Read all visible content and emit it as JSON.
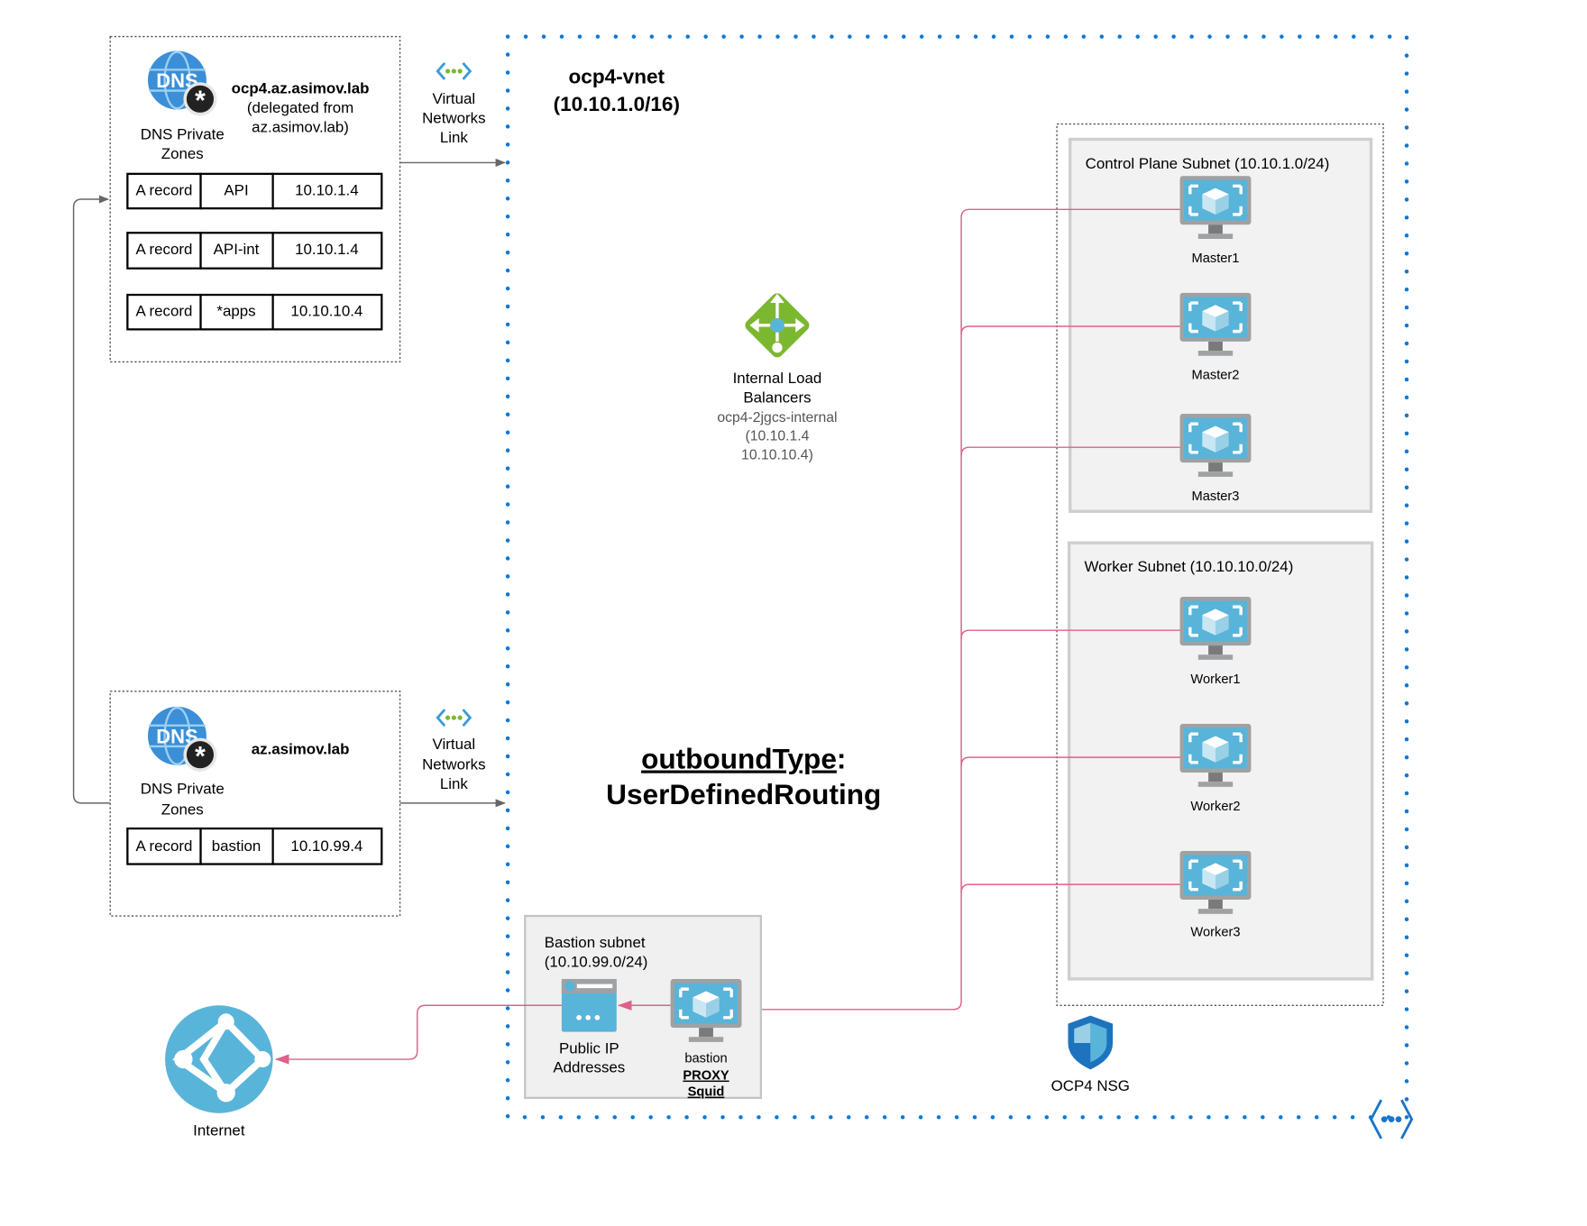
{
  "colors": {
    "vnet_border": "#0a78d7",
    "connection": "#e0608a",
    "subnet_fill": "#f2f2f2",
    "lb_green": "#7cb82f",
    "vm_blue": "#59b4d9"
  },
  "dns_zone_1": {
    "icon": "dns-private-zone-icon",
    "zone_name": "ocp4.az.asimov.lab",
    "zone_note_1": "(delegated from",
    "zone_note_2": "az.asimov.lab)",
    "label_1": "DNS Private",
    "label_2": "Zones",
    "records": [
      {
        "type": "A record",
        "name": "API",
        "ip": "10.10.1.4"
      },
      {
        "type": "A record",
        "name": "API-int",
        "ip": "10.10.1.4"
      },
      {
        "type": "A record",
        "name": "*apps",
        "ip": "10.10.10.4"
      }
    ]
  },
  "dns_zone_2": {
    "icon": "dns-private-zone-icon",
    "zone_name": "az.asimov.lab",
    "label_1": "DNS Private",
    "label_2": "Zones",
    "records": [
      {
        "type": "A record",
        "name": "bastion",
        "ip": "10.10.99.4"
      }
    ]
  },
  "vnet_link": {
    "line_1": "Virtual",
    "line_2": "Networks",
    "line_3": "Link"
  },
  "vnet": {
    "title_1": "ocp4-vnet",
    "title_2": "(10.10.1.0/16)"
  },
  "load_balancer": {
    "label_1": "Internal Load",
    "label_2": "Balancers",
    "name": "ocp4-2jgcs-internal",
    "ip_1": "(10.10.1.4",
    "ip_2": "10.10.10.4)"
  },
  "outbound": {
    "key": "outboundType",
    "colon": ":",
    "value": "UserDefinedRouting"
  },
  "control_plane": {
    "title": "Control Plane Subnet (10.10.1.0/24)",
    "nodes": [
      "Master1",
      "Master2",
      "Master3"
    ]
  },
  "worker": {
    "title": "Worker Subnet (10.10.10.0/24)",
    "nodes": [
      "Worker1",
      "Worker2",
      "Worker3"
    ]
  },
  "bastion_subnet": {
    "title_1": "Bastion subnet",
    "title_2": "(10.10.99.0/24)",
    "public_ip_1": "Public IP",
    "public_ip_2": "Addresses",
    "vm_name": "bastion",
    "vm_role_1": "PROXY",
    "vm_role_2": "Squid"
  },
  "internet": {
    "label": "Internet"
  },
  "nsg": {
    "label": "OCP4 NSG"
  }
}
